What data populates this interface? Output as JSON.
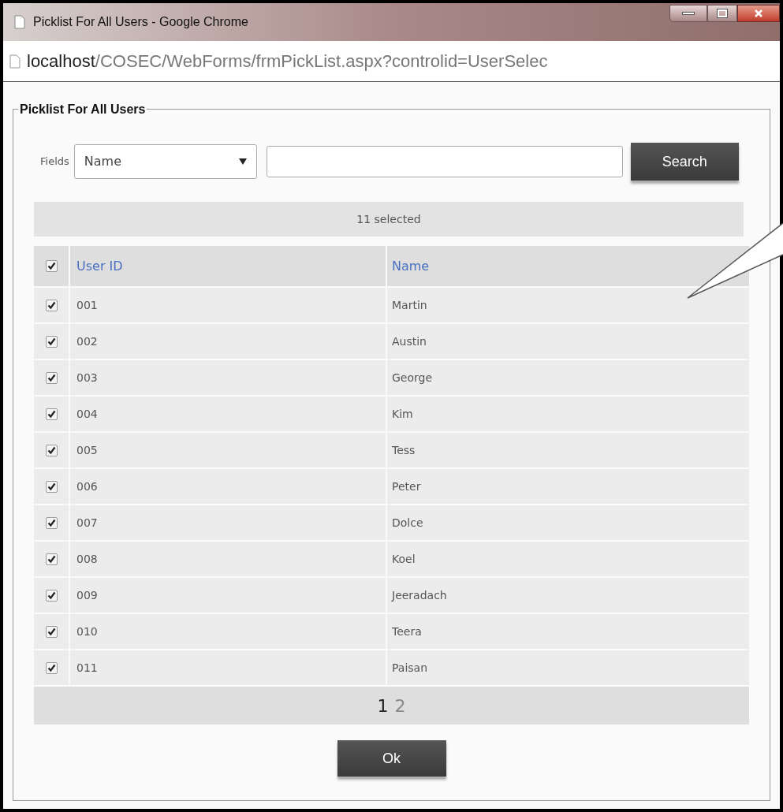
{
  "window": {
    "title": "Picklist For All Users - Google Chrome"
  },
  "address": {
    "host": "localhost",
    "path": "/COSEC/WebForms/frmPickList.aspx?controlid=UserSelec"
  },
  "legend": "Picklist For All Users",
  "search": {
    "fields_label": "Fields",
    "field_value": "Name",
    "button": "Search"
  },
  "selection_count": "11 selected",
  "table": {
    "all_checked": true,
    "columns": [
      "User ID",
      "Name"
    ],
    "rows": [
      {
        "id": "001",
        "name": "Martin",
        "checked": true
      },
      {
        "id": "002",
        "name": "Austin",
        "checked": true
      },
      {
        "id": "003",
        "name": "George",
        "checked": true
      },
      {
        "id": "004",
        "name": "Kim",
        "checked": true
      },
      {
        "id": "005",
        "name": "Tess",
        "checked": true
      },
      {
        "id": "006",
        "name": "Peter",
        "checked": true
      },
      {
        "id": "007",
        "name": "Dolce",
        "checked": true
      },
      {
        "id": "008",
        "name": "Koel",
        "checked": true
      },
      {
        "id": "009",
        "name": "Jeeradach",
        "checked": true
      },
      {
        "id": "010",
        "name": "Teera",
        "checked": true
      },
      {
        "id": "011",
        "name": "Paisan",
        "checked": true
      }
    ]
  },
  "pages": [
    {
      "label": "1",
      "selected": true
    },
    {
      "label": "2",
      "selected": false
    }
  ],
  "ok_button": "Ok"
}
